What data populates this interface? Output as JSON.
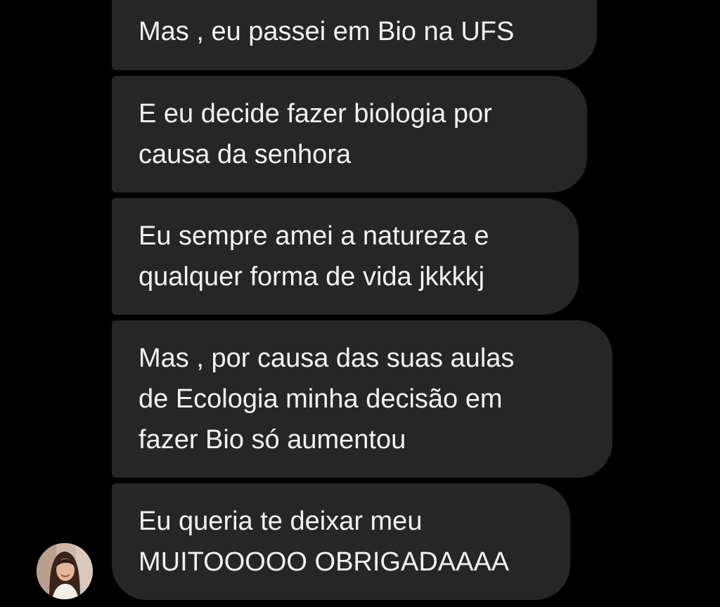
{
  "messages": [
    {
      "lines": [
        "Mas , eu passei em Bio na UFS"
      ]
    },
    {
      "lines": [
        "E eu decide fazer biologia por",
        "causa da senhora"
      ]
    },
    {
      "lines": [
        "Eu sempre amei a natureza e",
        "qualquer forma de vida jkkkkj"
      ]
    },
    {
      "lines": [
        "Mas , por causa das suas aulas",
        "de Ecologia minha decisão em",
        "fazer Bio só aumentou"
      ]
    },
    {
      "lines": [
        "Eu queria te deixar meu",
        "MUITOOOOO OBRIGADAAAA"
      ]
    }
  ],
  "avatar": {
    "icon": "user-photo-icon"
  },
  "colors": {
    "background": "#000000",
    "bubble": "#262626",
    "text": "#f2f2f2"
  }
}
